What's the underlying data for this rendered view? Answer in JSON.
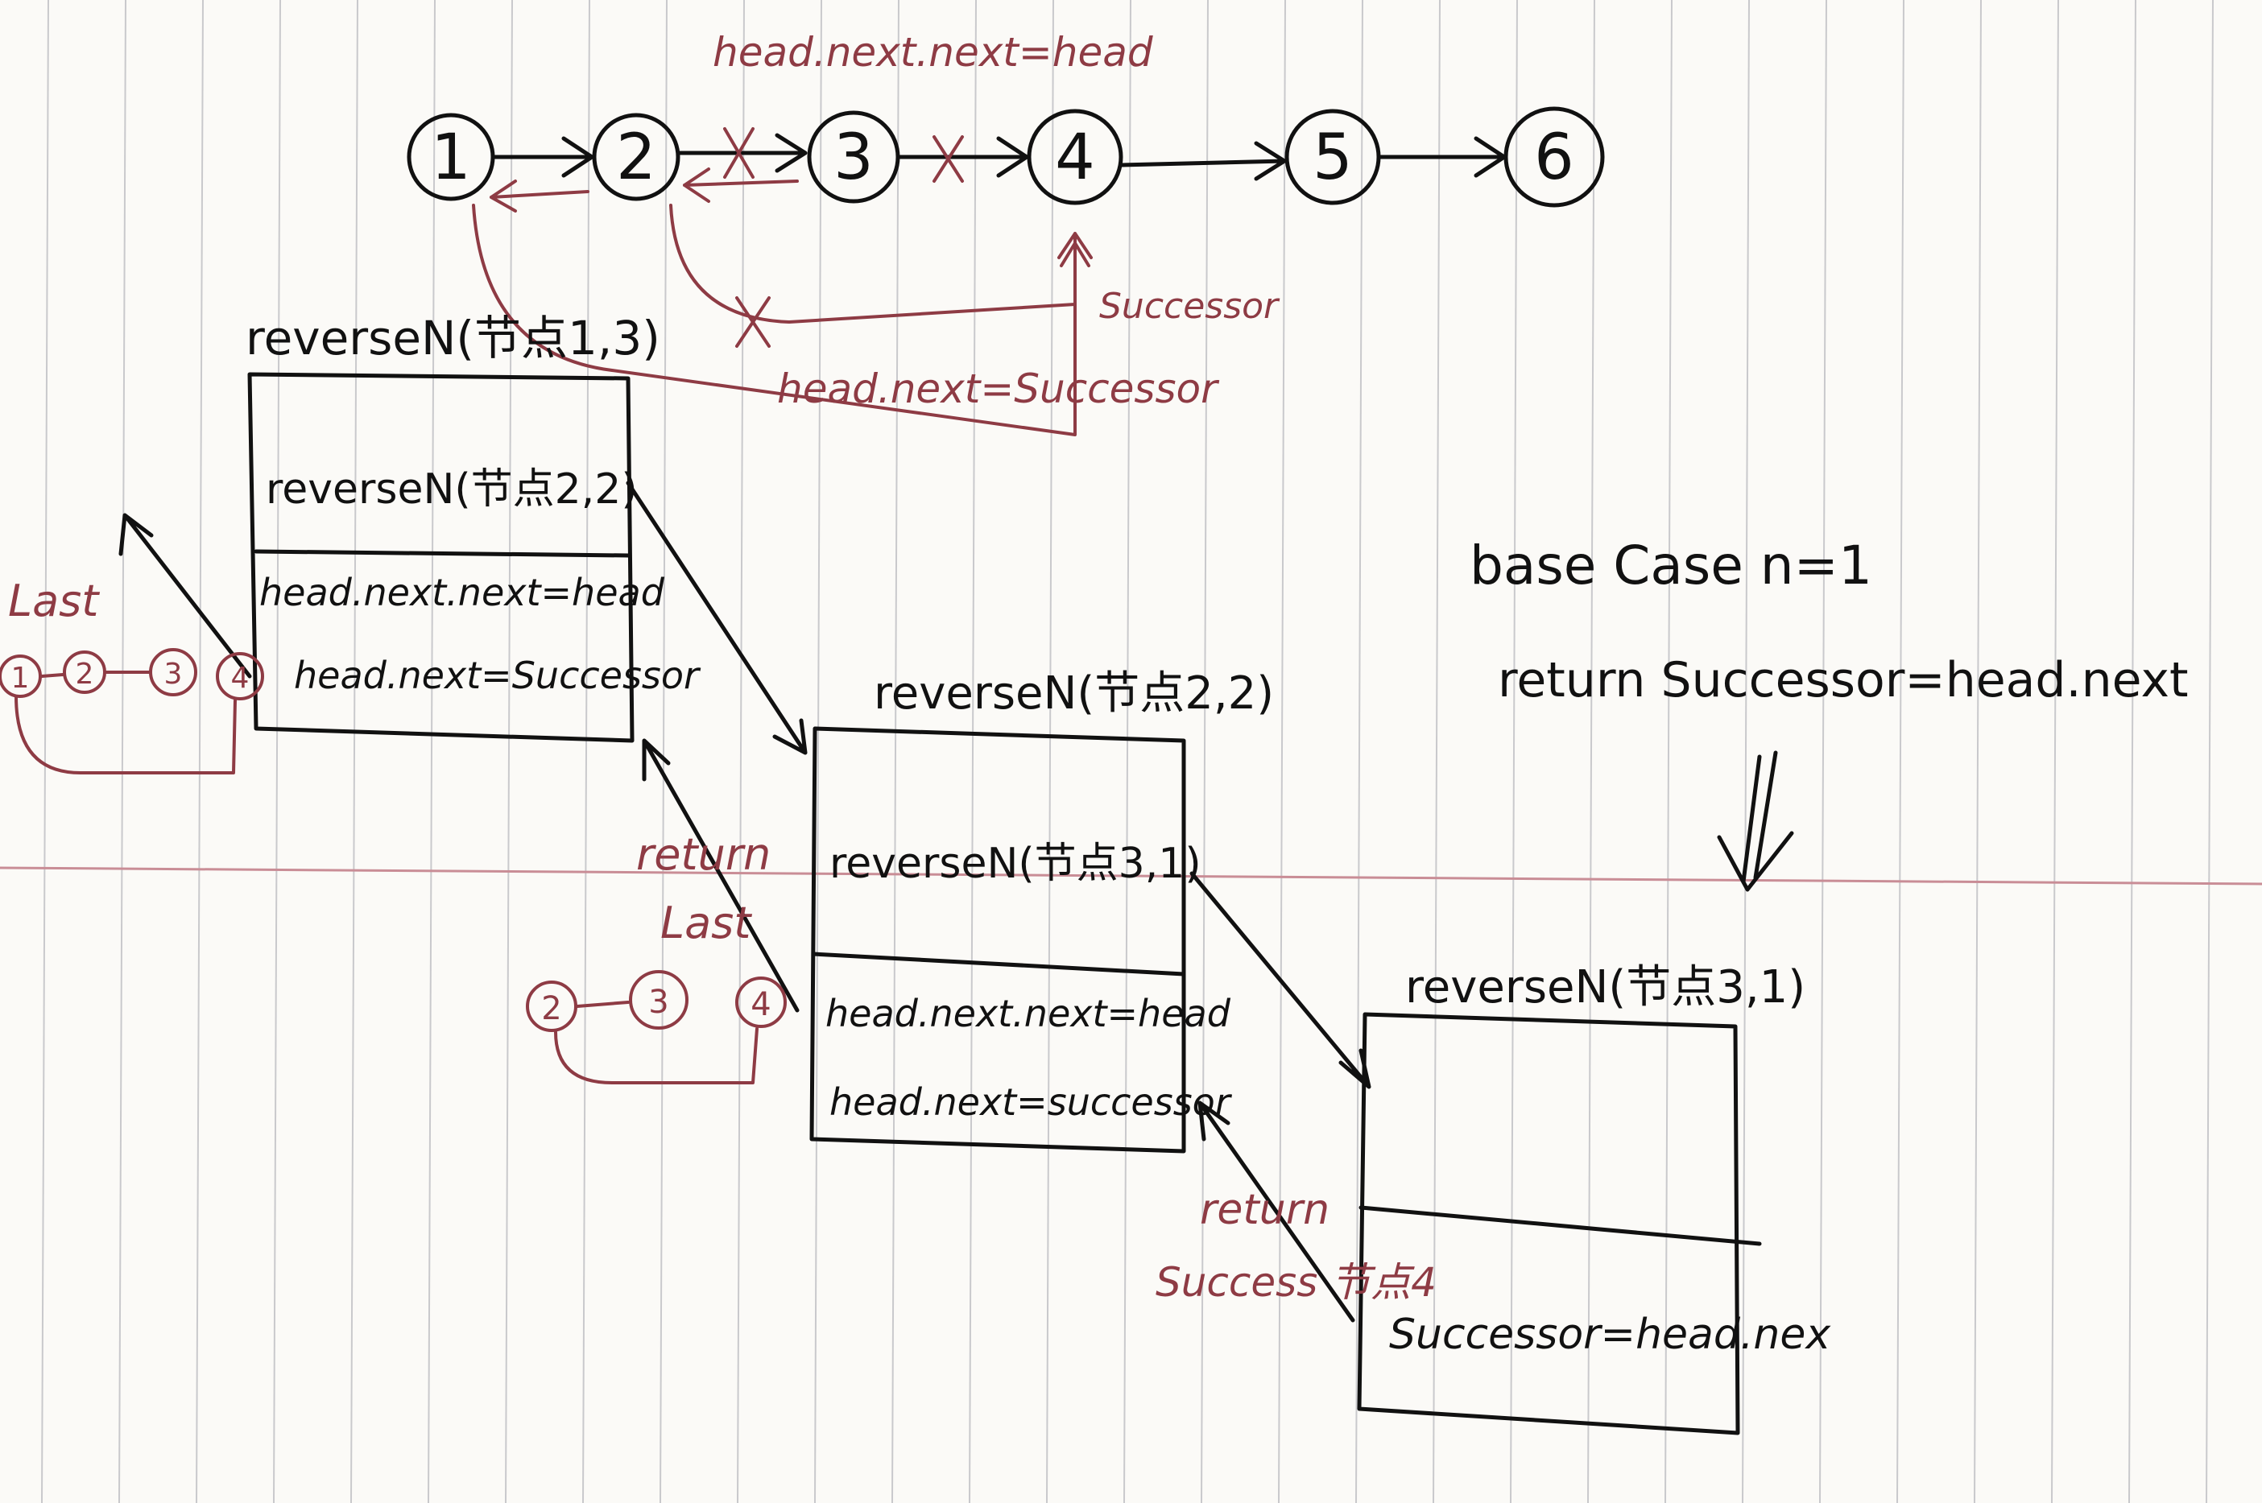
{
  "colors": {
    "paper": "#fbfaf7",
    "ruling": "#c9c9cc",
    "margin_line": "#c98d96",
    "ink": "#111111",
    "annotation": "#8e3b44"
  },
  "list_nodes": [
    "1",
    "2",
    "3",
    "4",
    "5",
    "6"
  ],
  "top_annotations": {
    "next_next": "head.next.next=head",
    "successor_tag": "Successor",
    "next_successor": "head.next=Successor"
  },
  "frames": {
    "outer": {
      "title": "reverseN(节点1,3)",
      "call": "reverseN(节点2,2)",
      "line1": "head.next.next=head",
      "line2": "head.next=Successor"
    },
    "middle": {
      "title": "reverseN(节点2,2)",
      "call": "reverseN(节点3,1)",
      "line1": "head.next.next=head",
      "line2": "head.next=successor"
    },
    "inner": {
      "title": "reverseN(节点3,1)",
      "line": "Successor=head.nex"
    }
  },
  "base_case": {
    "line1": "base Case  n=1",
    "line2": "return  Successor=head.next"
  },
  "annotations": {
    "last_left": "Last",
    "left_chain": [
      "1",
      "2",
      "3",
      "4"
    ],
    "return_label": "return",
    "last_mid": "Last",
    "mid_chain": [
      "2",
      "3",
      "4"
    ],
    "return_bottom": "return",
    "success_node": "Success 节点4"
  }
}
